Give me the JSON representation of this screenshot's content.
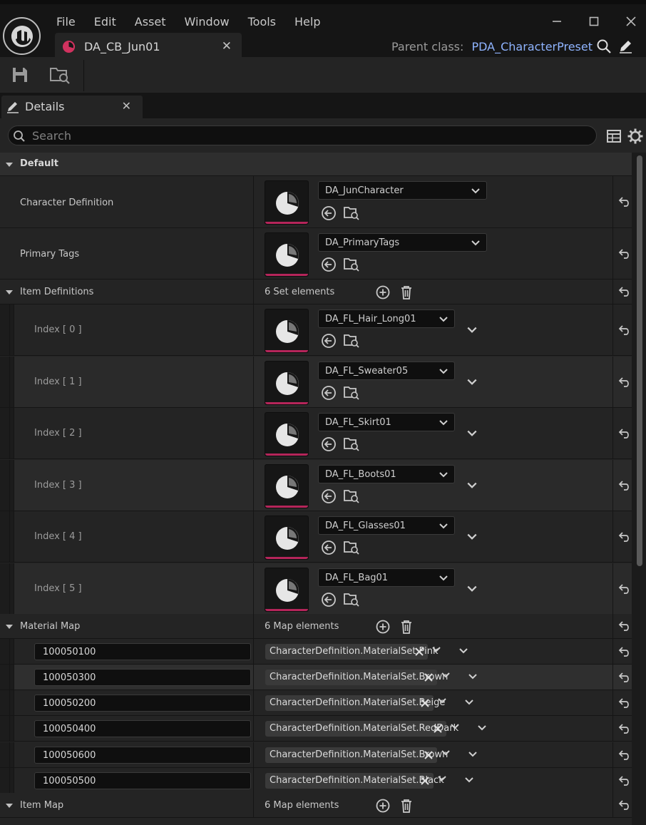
{
  "menu": [
    "File",
    "Edit",
    "Asset",
    "Window",
    "Tools",
    "Help"
  ],
  "document_tab": {
    "label": "DA_CB_Jun01"
  },
  "header": {
    "parent_class_label": "Parent class:",
    "parent_class_value": "PDA_CharacterPreset"
  },
  "details_tab": {
    "label": "Details"
  },
  "search": {
    "placeholder": "Search"
  },
  "categories": {
    "default": "Default",
    "item_definitions": "Item Definitions",
    "material_map": "Material Map",
    "item_map": "Item Map"
  },
  "properties": {
    "character_definition": {
      "label": "Character Definition",
      "value": "DA_JunCharacter"
    },
    "primary_tags": {
      "label": "Primary Tags",
      "value": "DA_PrimaryTags"
    }
  },
  "item_definitions": {
    "count": "6 Set elements",
    "items": [
      {
        "label": "Index [ 0 ]",
        "value": "DA_FL_Hair_Long01"
      },
      {
        "label": "Index [ 1 ]",
        "value": "DA_FL_Sweater05"
      },
      {
        "label": "Index [ 2 ]",
        "value": "DA_FL_Skirt01"
      },
      {
        "label": "Index [ 3 ]",
        "value": "DA_FL_Boots01"
      },
      {
        "label": "Index [ 4 ]",
        "value": "DA_FL_Glasses01"
      },
      {
        "label": "Index [ 5 ]",
        "value": "DA_FL_Bag01"
      }
    ]
  },
  "material_map": {
    "count": "6 Map elements",
    "entries": [
      {
        "key": "100050100",
        "tag": "CharacterDefinition.MaterialSet.Pink"
      },
      {
        "key": "100050300",
        "tag": "CharacterDefinition.MaterialSet.Brown"
      },
      {
        "key": "100050200",
        "tag": "CharacterDefinition.MaterialSet.Beige"
      },
      {
        "key": "100050400",
        "tag": "CharacterDefinition.MaterialSet.RedDark"
      },
      {
        "key": "100050600",
        "tag": "CharacterDefinition.MaterialSet.Brown"
      },
      {
        "key": "100050500",
        "tag": "CharacterDefinition.MaterialSet.Black"
      }
    ]
  },
  "item_map": {
    "count": "6 Map elements"
  },
  "colors": {
    "accent_link": "#8fb4ff",
    "thumbnail_bar": "#b5255a",
    "tab_icon": "#d1325f"
  }
}
